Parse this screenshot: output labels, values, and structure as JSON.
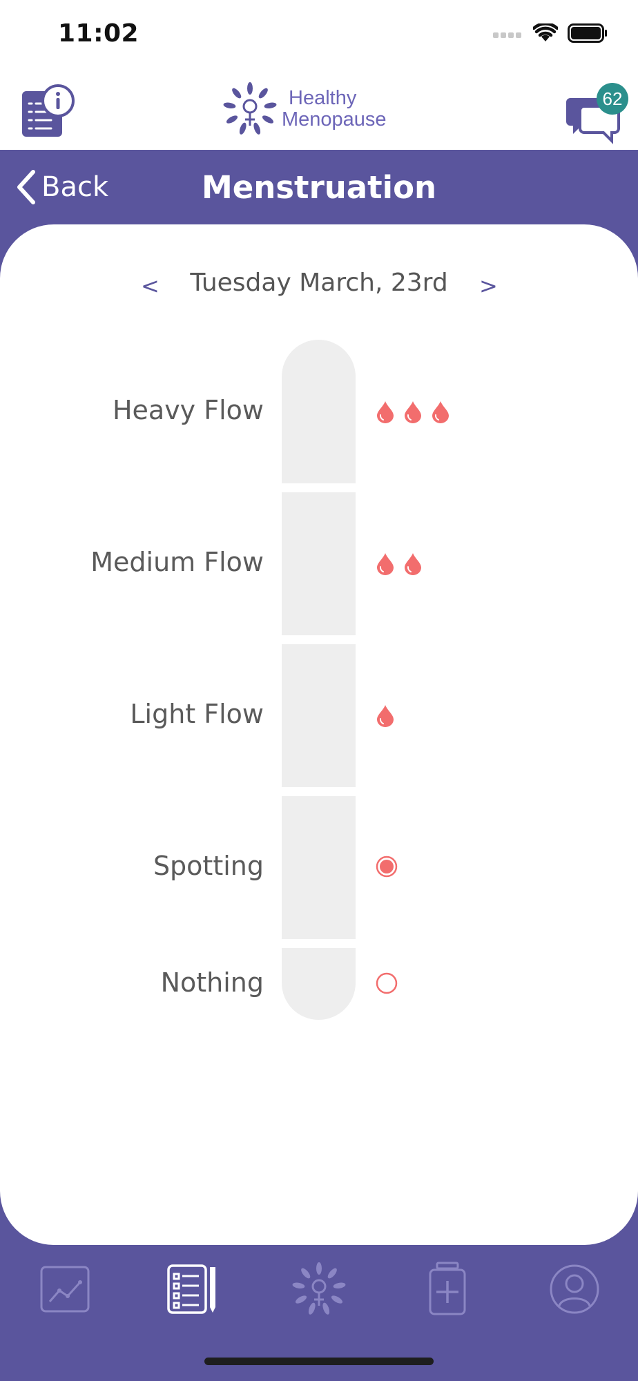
{
  "status_bar": {
    "time": "11:02"
  },
  "header": {
    "logo_line1": "Healthy",
    "logo_line2": "Menopause",
    "chat_badge_count": "62"
  },
  "nav": {
    "back_label": "Back",
    "title": "Menstruation"
  },
  "date_nav": {
    "prev_label": "<",
    "date": "Tuesday March, 23rd",
    "next_label": ">"
  },
  "flow_options": [
    {
      "label": "Heavy Flow",
      "icon": "drop",
      "count": 3
    },
    {
      "label": "Medium Flow",
      "icon": "drop",
      "count": 2
    },
    {
      "label": "Light Flow",
      "icon": "drop",
      "count": 1
    },
    {
      "label": "Spotting",
      "icon": "filled-circle",
      "count": 1
    },
    {
      "label": "Nothing",
      "icon": "empty-circle",
      "count": 1
    }
  ],
  "tabs": [
    {
      "icon": "chart-icon",
      "active": false
    },
    {
      "icon": "journal-icon",
      "active": true
    },
    {
      "icon": "flower-logo-icon",
      "active": false
    },
    {
      "icon": "medicine-icon",
      "active": false
    },
    {
      "icon": "profile-icon",
      "active": false
    }
  ],
  "colors": {
    "brand_purple": "#5a559d",
    "flow_red": "#f26d6d",
    "badge_teal": "#2b8f8c"
  }
}
